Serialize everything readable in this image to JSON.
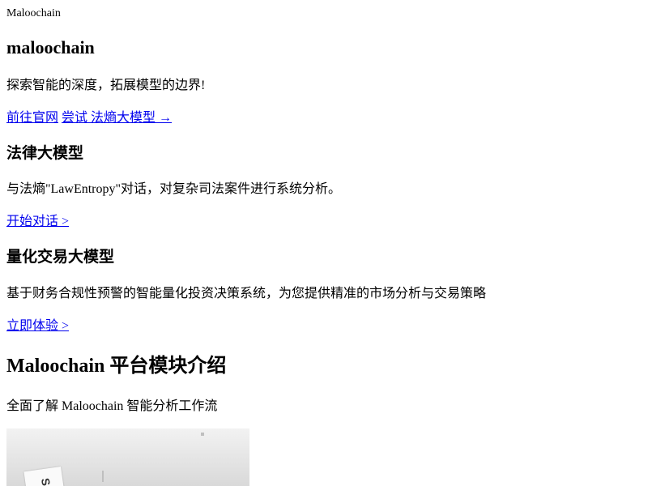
{
  "header": {
    "brand": "Maloochain"
  },
  "hero": {
    "title": "maloochain",
    "tagline": "探索智能的深度，拓展模型的边界!",
    "links": [
      {
        "label": "前往官网"
      },
      {
        "label": "尝试 法熵大模型 →"
      }
    ]
  },
  "sections": [
    {
      "title": "法律大模型",
      "description": "与法熵\"LawEntropy\"对话，对复杂司法案件进行系统分析。",
      "cta": "开始对话 >"
    },
    {
      "title": "量化交易大模型",
      "description": "基于财务合规性预警的智能量化投资决策系统，为您提供精准的市场分析与交易策略",
      "cta": "立即体验 >"
    }
  ],
  "modules": {
    "title": "Maloochain 平台模块介绍",
    "subtitle": "全面了解 Maloochain 智能分析工作流",
    "image": {
      "visible_text": "S"
    }
  }
}
